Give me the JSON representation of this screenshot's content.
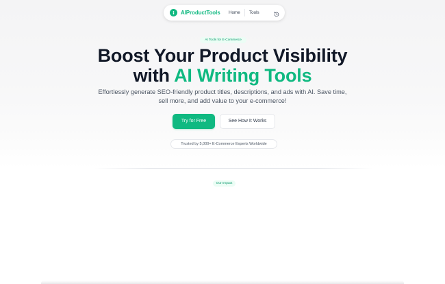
{
  "navbar": {
    "logo_text": "AIProductTools",
    "links": [
      {
        "label": "Home"
      },
      {
        "label": "Tools"
      }
    ],
    "history_icon": "history-icon"
  },
  "hero": {
    "badge": "AI Tools for E-Commerce",
    "headline_line1": "Boost Your Product Visibility",
    "headline_line2_prefix": "with ",
    "headline_line2_accent": "AI Writing Tools",
    "subtitle": "Effortlessly generate SEO-friendly product titles, descriptions, and ads with AI. Save time, sell more, and add value to your e-commerce!",
    "primary_button": "Try for Free",
    "secondary_button": "See How It Works",
    "trust_text": "Trusted by 5,000+ E-Commerce Experts Worldwide"
  },
  "impact": {
    "badge": "Our Impact"
  },
  "colors": {
    "accent": "#10b981",
    "accent_soft": "#ecfdf5",
    "heading": "#111827",
    "body_text": "#4b5563"
  }
}
